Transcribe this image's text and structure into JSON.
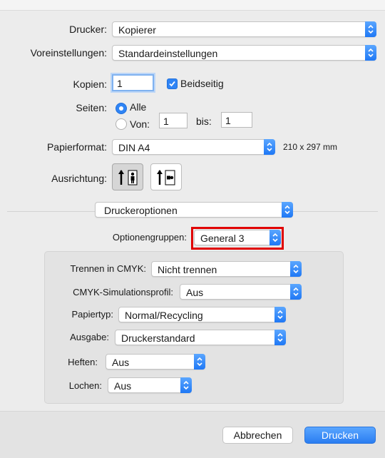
{
  "printer": {
    "label": "Drucker:",
    "value": "Kopierer"
  },
  "presets": {
    "label": "Voreinstellungen:",
    "value": "Standardeinstellungen"
  },
  "copies": {
    "label": "Kopien:",
    "value": "1",
    "duplex_label": "Beidseitig",
    "duplex_checked": true
  },
  "pages": {
    "label": "Seiten:",
    "all_label": "Alle",
    "from_label": "Von:",
    "from_value": "1",
    "to_label": "bis:",
    "to_value": "1",
    "selected": "all"
  },
  "paper": {
    "label": "Papierformat:",
    "value": "DIN A4",
    "size_text": "210 x 297 mm"
  },
  "orientation": {
    "label": "Ausrichtung:",
    "selected": "portrait"
  },
  "section_popup": {
    "value": "Druckeroptionen"
  },
  "option_groups": {
    "label": "Optionengruppen:",
    "value": "General 3"
  },
  "options": [
    {
      "label": "Trennen in CMYK:",
      "value": "Nicht trennen"
    },
    {
      "label": "CMYK-Simulationsprofil:",
      "value": "Aus"
    },
    {
      "label": "Papiertyp:",
      "value": "Normal/Recycling"
    },
    {
      "label": "Ausgabe:",
      "value": "Druckerstandard"
    },
    {
      "label": "Heften:",
      "value": "Aus"
    },
    {
      "label": "Lochen:",
      "value": "Aus"
    }
  ],
  "buttons": {
    "cancel": "Abbrechen",
    "print": "Drucken"
  },
  "colors": {
    "accent": "#2f84f5",
    "highlight": "#e00000"
  }
}
